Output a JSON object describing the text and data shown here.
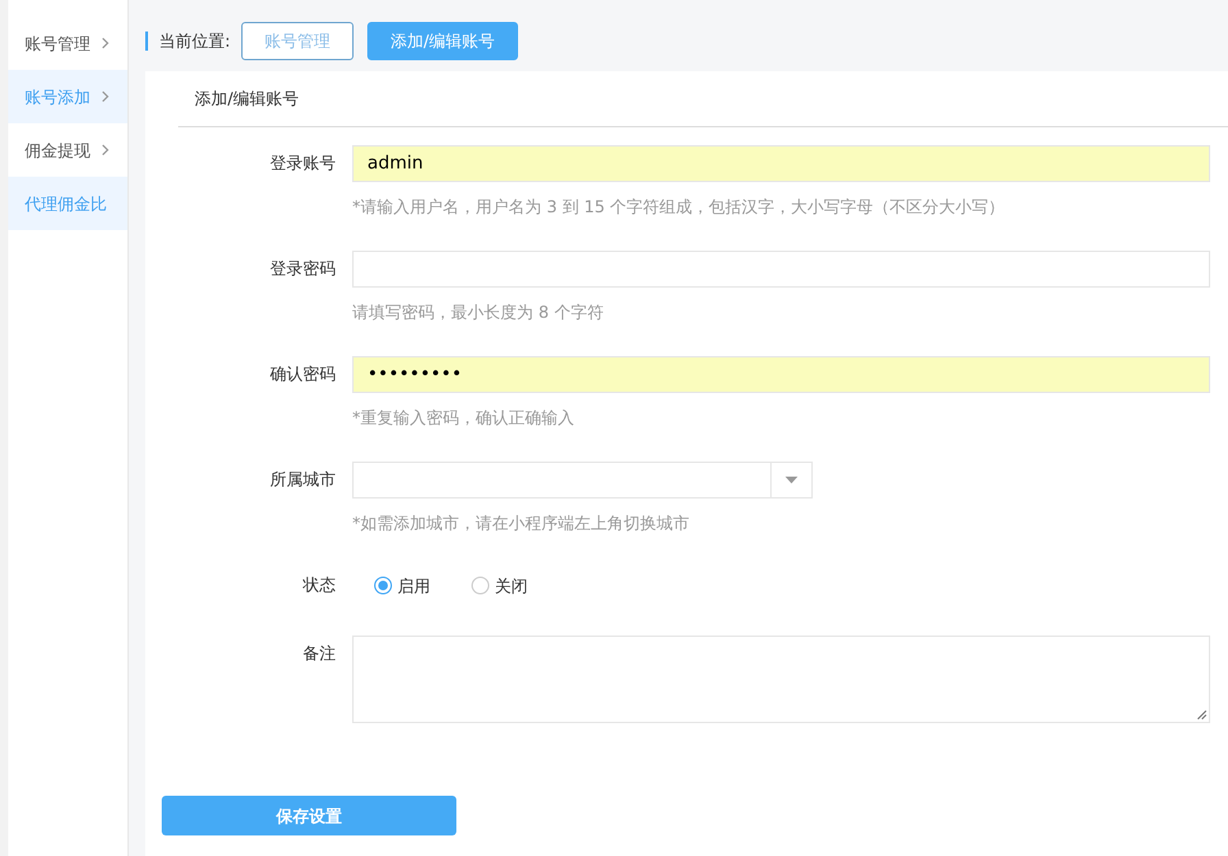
{
  "sidebar": {
    "items": [
      {
        "label": "账号管理",
        "kind": "expandable",
        "selected": false
      },
      {
        "label": "账号添加",
        "kind": "expandable",
        "selected": true
      },
      {
        "label": "佣金提现",
        "kind": "expandable",
        "selected": false
      },
      {
        "label": "代理佣金比",
        "kind": "link",
        "selected": true
      }
    ]
  },
  "breadcrumb": {
    "label": "当前位置:",
    "items": [
      {
        "label": "账号管理",
        "selected": false
      },
      {
        "label": "添加/编辑账号",
        "selected": true
      }
    ]
  },
  "panel": {
    "title": "添加/编辑账号"
  },
  "form": {
    "fields": [
      {
        "kind": "text",
        "label": "登录账号",
        "value": "admin",
        "autofilled": true,
        "hint": "*请输入用户名，用户名为 3 到 15 个字符组成，包括汉字，大小写字母（不区分大小写）"
      },
      {
        "kind": "text",
        "label": "登录密码",
        "autofilled": false,
        "hint": "请填写密码，最小长度为 8 个字符"
      },
      {
        "kind": "text",
        "label": "确认密码",
        "value": "•••••••••",
        "autofilled": true,
        "hint": "*重复输入密码，确认正确输入"
      },
      {
        "kind": "select",
        "label": "所属城市",
        "hint": "*如需添加城市，请在小程序端左上角切换城市"
      },
      {
        "kind": "radio",
        "label": "状态",
        "options": [
          {
            "label": "启用",
            "selected": true
          },
          {
            "label": "关闭",
            "selected": false
          }
        ]
      },
      {
        "kind": "textarea",
        "label": "备注"
      }
    ]
  },
  "save_button": "保存设置"
}
